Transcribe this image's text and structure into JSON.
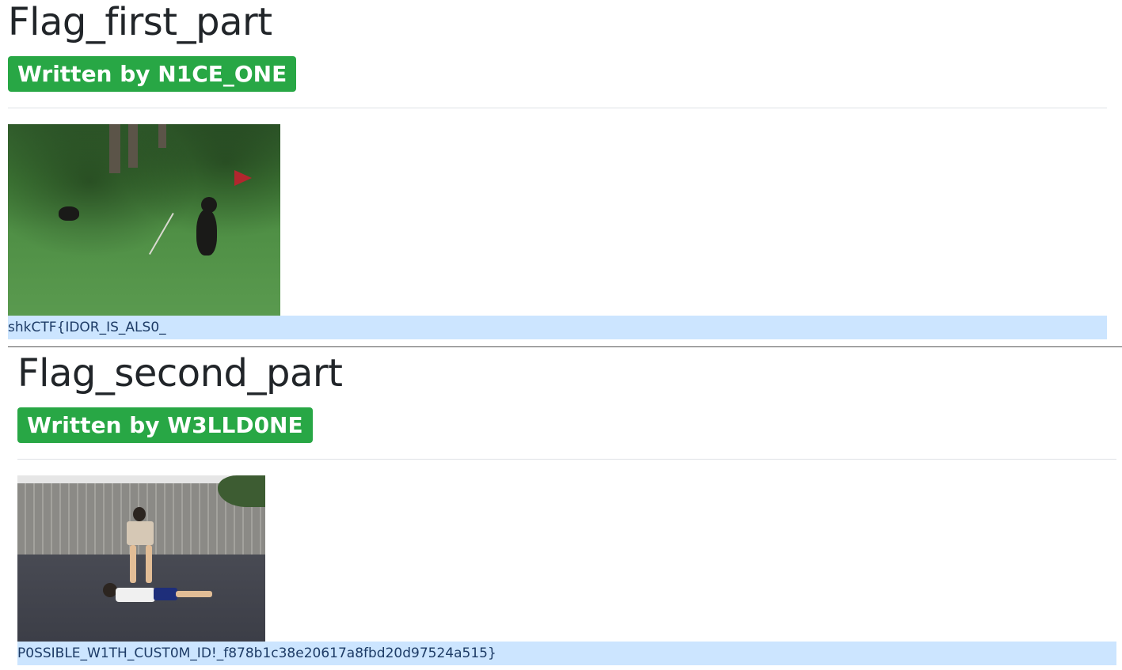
{
  "posts": [
    {
      "title": "Flag_first_part",
      "author_badge": "Written by N1CE_ONE",
      "image": "bear-golf-gif",
      "flag_text": "shkCTF{IDOR_IS_ALS0_"
    },
    {
      "title": "Flag_second_part",
      "author_badge": "Written by W3LLD0NE",
      "image": "kids-driveway-gif",
      "flag_text": "P0SSIBLE_W1TH_CUST0M_ID!_f878b1c38e20617a8fbd20d97524a515}"
    }
  ],
  "colors": {
    "badge": "#28a745",
    "flag_highlight": "#cce5ff",
    "text": "#212529"
  }
}
